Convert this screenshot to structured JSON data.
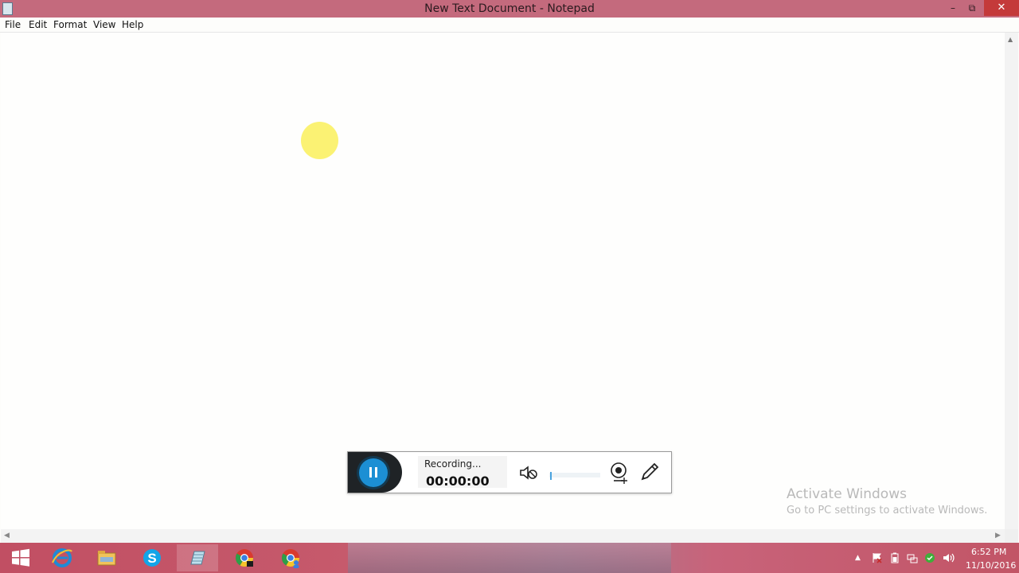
{
  "window": {
    "title": "New Text Document - Notepad",
    "minimize_glyph": "–",
    "maximize_glyph": "⧉",
    "close_glyph": "✕"
  },
  "menu": {
    "items": [
      {
        "label": "File"
      },
      {
        "label": "Edit"
      },
      {
        "label": "Format"
      },
      {
        "label": "View"
      },
      {
        "label": "Help"
      }
    ]
  },
  "editor": {
    "content": ""
  },
  "recorder": {
    "status_label": "Recording...",
    "timer": "00:00:00",
    "pause_icon": "pause-icon",
    "mute_icon": "speaker-muted-icon",
    "webcam_icon": "webcam-add-icon",
    "pen_icon": "pencil-icon",
    "volume_level": 0.02,
    "accent_color": "#1c8fd4"
  },
  "watermark": {
    "title": "Activate Windows",
    "subtitle": "Go to PC settings to activate Windows."
  },
  "taskbar": {
    "apps": [
      {
        "name": "windows-start-icon"
      },
      {
        "name": "internet-explorer-icon"
      },
      {
        "name": "file-explorer-icon"
      },
      {
        "name": "skype-icon"
      },
      {
        "name": "notepad-icon"
      },
      {
        "name": "chrome-icon"
      },
      {
        "name": "chrome-profile-icon"
      }
    ],
    "tray": {
      "show_hidden_glyph": "▲",
      "time": "6:52 PM",
      "date": "11/10/2016"
    }
  }
}
